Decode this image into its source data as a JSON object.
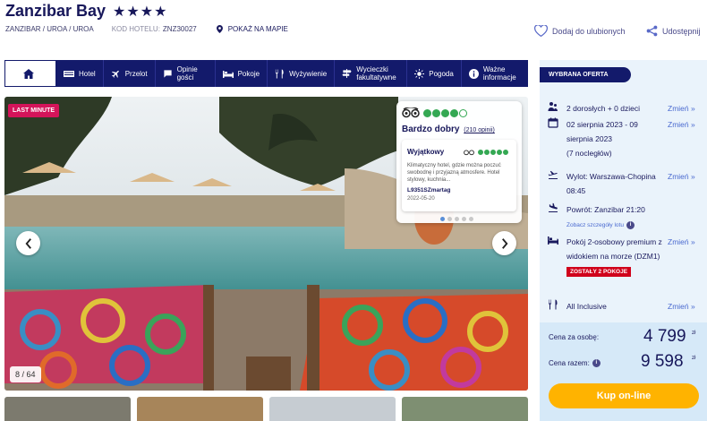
{
  "hotel": {
    "name": "Zanzibar Bay",
    "stars": "★★★★",
    "location": "ZANZIBAR / UROA / UROA",
    "code_label": "KOD HOTELU:",
    "code": "ZNZ30027",
    "map_link": "POKAŻ NA MAPIE",
    "favorite": "Dodaj do ulubionych",
    "share": "Udostępnij"
  },
  "tabs": [
    {
      "label": "",
      "icon": "home-icon"
    },
    {
      "label": "Hotel",
      "icon": "hotel-icon"
    },
    {
      "label": "Przelot",
      "icon": "plane-icon"
    },
    {
      "label": "Opinie gości",
      "icon": "comment-icon"
    },
    {
      "label": "Pokoje",
      "icon": "bed-icon"
    },
    {
      "label": "Wyżywienie",
      "icon": "cutlery-icon"
    },
    {
      "label": "Wycieczki fakultatywne",
      "icon": "signpost-icon"
    },
    {
      "label": "Pogoda",
      "icon": "sun-icon"
    },
    {
      "label": "Ważne informacje",
      "icon": "info-icon"
    }
  ],
  "gallery": {
    "badge": "LAST MINUTE",
    "counter": "8 / 64",
    "review": {
      "verdict": "Bardzo dobry",
      "count": "(210 opinii)",
      "rating_bubbles": 4,
      "inner_title": "Wyjątkowy",
      "inner_text": "Klimatyczny hotel, gdzie można poczuć swobodnę i przyjazną atmosfere. Hotel stylowy, kuchnia...",
      "user": "L9351SZmartag",
      "date": "2022-05-20"
    }
  },
  "offer": {
    "header": "WYBRANA OFERTA",
    "change_label": "Zmień",
    "persons": "2 dorosłych + 0 dzieci",
    "dates": "02 sierpnia 2023 - 09 sierpnia 2023",
    "nights": "(7 nocległów)",
    "departure": "Wylot: Warszawa-Chopina 08:45",
    "return": "Powrót: Zanzibar 21:20",
    "flight_details": "Zobacz szczegóły lotu",
    "room": "Pokój 2-osobowy premium z widokiem na morze (DZM1)",
    "rooms_left": "ZOSTAŁY 2 POKOJE",
    "board": "All Inclusive",
    "price_person_label": "Cena za osobę:",
    "price_person": "4 799",
    "price_total_label": "Cena razem:",
    "price_total": "9 598",
    "currency": "zł",
    "buy": "Kup on-line"
  },
  "colors": {
    "navy": "#131a6b",
    "accent": "#ffb300",
    "link": "#4a6ad0",
    "badge": "#d4145a",
    "alert": "#d0021b"
  }
}
